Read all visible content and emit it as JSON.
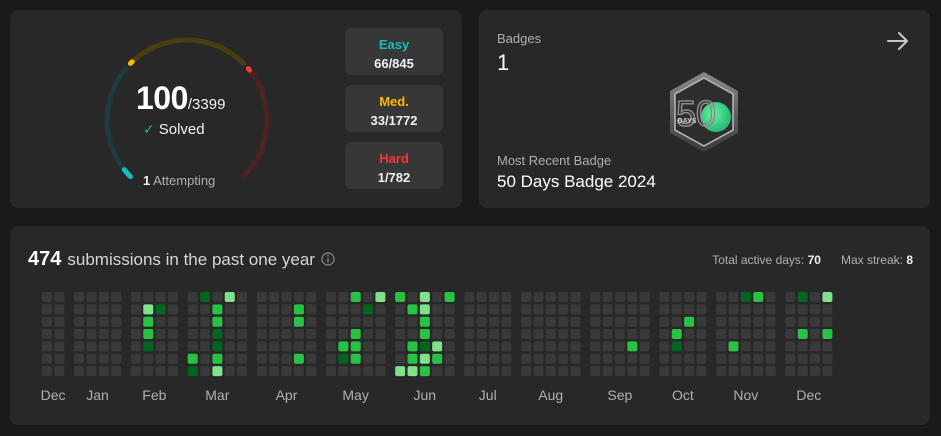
{
  "progress": {
    "solved": "100",
    "total": "/3399",
    "solved_label": "Solved",
    "attempting_count": "1",
    "attempting_label": "Attempting",
    "easy": {
      "label": "Easy",
      "value": "66/845",
      "color": "#1cbaba",
      "fraction": 0.078
    },
    "medium": {
      "label": "Med.",
      "value": "33/1772",
      "color": "#ffb700",
      "fraction": 0.019
    },
    "hard": {
      "label": "Hard",
      "value": "1/782",
      "color": "#f63737",
      "fraction": 0.001
    }
  },
  "badges": {
    "title": "Badges",
    "count": "1",
    "badge_day_number": "50",
    "badge_day_text": "DAYS",
    "recent_title": "Most Recent Badge",
    "recent_name": "50 Days Badge 2024"
  },
  "calendar": {
    "count": "474",
    "text": "submissions in the past one year",
    "active_days_label": "Total active days:",
    "active_days": "70",
    "max_streak_label": "Max streak:",
    "max_streak": "8",
    "months": [
      "Dec",
      "Jan",
      "Feb",
      "Mar",
      "Apr",
      "May",
      "Jun",
      "Jul",
      "Aug",
      "Sep",
      "Oct",
      "Nov",
      "Dec"
    ],
    "colors": [
      "#393939",
      "#016620",
      "#28c244",
      "#7fe18b"
    ],
    "month_weeks": [
      [
        [
          0,
          0,
          0,
          0,
          0,
          0,
          0
        ],
        [
          0,
          0,
          0,
          0,
          0,
          0,
          0
        ]
      ],
      [
        [
          0,
          0,
          0,
          0,
          0,
          0,
          0
        ],
        [
          0,
          0,
          0,
          0,
          0,
          0,
          0
        ],
        [
          0,
          0,
          0,
          0,
          0,
          0,
          0
        ],
        [
          0,
          0,
          0,
          0,
          0,
          0,
          0
        ]
      ],
      [
        [
          0,
          0,
          0,
          0,
          0,
          0,
          0
        ],
        [
          0,
          3,
          2,
          2,
          1,
          0,
          0
        ],
        [
          0,
          1,
          0,
          0,
          0,
          0,
          0
        ],
        [
          0,
          0,
          0,
          0,
          0,
          0,
          0
        ]
      ],
      [
        [
          0,
          0,
          0,
          0,
          0,
          2,
          1
        ],
        [
          1,
          0,
          0,
          0,
          0,
          0,
          0
        ],
        [
          0,
          2,
          2,
          1,
          1,
          2,
          3
        ],
        [
          3,
          0,
          0,
          0,
          0,
          0,
          0
        ],
        [
          0,
          0,
          0,
          0,
          0,
          0,
          0
        ]
      ],
      [
        [
          0,
          0,
          0,
          0,
          0,
          0,
          0
        ],
        [
          0,
          0,
          0,
          0,
          0,
          0,
          0
        ],
        [
          0,
          0,
          0,
          0,
          0,
          0,
          0
        ],
        [
          0,
          2,
          2,
          0,
          0,
          2,
          0
        ],
        [
          0,
          0,
          0,
          0,
          0,
          0,
          0
        ]
      ],
      [
        [
          0,
          0,
          0,
          0,
          0,
          0,
          0
        ],
        [
          0,
          0,
          0,
          0,
          2,
          1,
          0
        ],
        [
          2,
          0,
          0,
          2,
          2,
          2,
          0
        ],
        [
          0,
          1,
          0,
          0,
          0,
          0,
          0
        ],
        [
          3,
          0,
          0,
          0,
          0,
          0,
          0
        ]
      ],
      [
        [
          2,
          0,
          0,
          0,
          0,
          0,
          3
        ],
        [
          0,
          2,
          0,
          0,
          2,
          2,
          3
        ],
        [
          3,
          3,
          2,
          2,
          1,
          3,
          2
        ],
        [
          0,
          0,
          0,
          0,
          3,
          2,
          0
        ],
        [
          2,
          0,
          0,
          0,
          0,
          0,
          0
        ]
      ],
      [
        [
          0,
          0,
          0,
          0,
          0,
          0,
          0
        ],
        [
          0,
          0,
          0,
          0,
          0,
          0,
          0
        ],
        [
          0,
          0,
          0,
          0,
          0,
          0,
          0
        ],
        [
          0,
          0,
          0,
          0,
          0,
          0,
          0
        ]
      ],
      [
        [
          0,
          0,
          0,
          0,
          0,
          0,
          0
        ],
        [
          0,
          0,
          0,
          0,
          0,
          0,
          0
        ],
        [
          0,
          0,
          0,
          0,
          0,
          0,
          0
        ],
        [
          0,
          0,
          0,
          0,
          0,
          0,
          0
        ],
        [
          0,
          0,
          0,
          0,
          0,
          0,
          0
        ]
      ],
      [
        [
          0,
          0,
          0,
          0,
          0,
          0,
          0
        ],
        [
          0,
          0,
          0,
          0,
          0,
          0,
          0
        ],
        [
          0,
          0,
          0,
          0,
          0,
          0,
          0
        ],
        [
          0,
          0,
          0,
          0,
          2,
          0,
          0
        ],
        [
          0,
          0,
          0,
          0,
          0,
          0,
          0
        ]
      ],
      [
        [
          0,
          0,
          0,
          0,
          0,
          0,
          0
        ],
        [
          0,
          0,
          0,
          2,
          1,
          0,
          0
        ],
        [
          0,
          0,
          2,
          0,
          0,
          0,
          0
        ],
        [
          0,
          0,
          0,
          0,
          0,
          0,
          0
        ]
      ],
      [
        [
          0,
          0,
          0,
          0,
          0,
          0,
          0
        ],
        [
          0,
          0,
          0,
          0,
          2,
          0,
          0
        ],
        [
          1,
          0,
          0,
          0,
          0,
          0,
          0
        ],
        [
          2,
          0,
          0,
          0,
          0,
          0,
          0
        ],
        [
          0,
          0,
          0,
          0,
          0,
          0,
          0
        ]
      ],
      [
        [
          0,
          0,
          0,
          0,
          0,
          0,
          0
        ],
        [
          1,
          0,
          0,
          2,
          0,
          0,
          0
        ],
        [
          0,
          0,
          0,
          0,
          0,
          0,
          0
        ],
        [
          3,
          0,
          0,
          2,
          0,
          0,
          0
        ]
      ]
    ]
  }
}
